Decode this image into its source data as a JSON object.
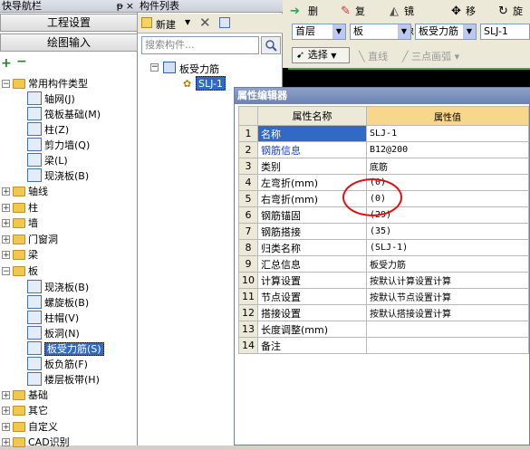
{
  "nav": {
    "title": "快导航栏",
    "pin": "ᵽ",
    "close": "×",
    "buttons": [
      "工程设置",
      "绘图输入"
    ],
    "tree": [
      {
        "label": "常用构件类型",
        "type": "folder",
        "expanded": true
      },
      {
        "label": "轴网(J)",
        "type": "item"
      },
      {
        "label": "筏板基础(M)",
        "type": "item"
      },
      {
        "label": "柱(Z)",
        "type": "item"
      },
      {
        "label": "剪力墙(Q)",
        "type": "item"
      },
      {
        "label": "梁(L)",
        "type": "item"
      },
      {
        "label": "现浇板(B)",
        "type": "item"
      },
      {
        "label": "轴线",
        "type": "folder"
      },
      {
        "label": "柱",
        "type": "folder"
      },
      {
        "label": "墙",
        "type": "folder"
      },
      {
        "label": "门窗洞",
        "type": "folder"
      },
      {
        "label": "梁",
        "type": "folder"
      },
      {
        "label": "板",
        "type": "folder",
        "expanded": true
      },
      {
        "label": "现浇板(B)",
        "type": "item"
      },
      {
        "label": "螺旋板(B)",
        "type": "item"
      },
      {
        "label": "柱帽(V)",
        "type": "item"
      },
      {
        "label": "板洞(N)",
        "type": "item"
      },
      {
        "label": "板受力筋(S)",
        "type": "item",
        "selected": true
      },
      {
        "label": "板负筋(F)",
        "type": "item"
      },
      {
        "label": "楼层板带(H)",
        "type": "item"
      },
      {
        "label": "基础",
        "type": "folder"
      },
      {
        "label": "其它",
        "type": "folder"
      },
      {
        "label": "自定义",
        "type": "folder"
      },
      {
        "label": "CAD识别",
        "type": "folder"
      }
    ]
  },
  "component_list": {
    "title": "构件列表",
    "new_label": "新建",
    "search_placeholder": "搜索构件...",
    "root": "板受力筋",
    "child": "SLJ-1"
  },
  "toolbar": {
    "delete": "删除",
    "copy": "复制",
    "mirror": "镜像",
    "move": "移动",
    "rotate": "旋转",
    "floor": "首层",
    "category": "板",
    "type": "板受力筋",
    "component": "SLJ-1",
    "select": "选择",
    "line": "直线",
    "arc": "三点画弧"
  },
  "property_editor": {
    "title": "属性编辑器",
    "col_name": "属性名称",
    "col_value": "属性值",
    "rows": [
      {
        "n": "1",
        "name": "名称",
        "value": "SLJ-1"
      },
      {
        "n": "2",
        "name": "钢筋信息",
        "value": "B12@200"
      },
      {
        "n": "3",
        "name": "类别",
        "value": "底筋"
      },
      {
        "n": "4",
        "name": "左弯折(mm)",
        "value": "(0)"
      },
      {
        "n": "5",
        "name": "右弯折(mm)",
        "value": "(0)"
      },
      {
        "n": "6",
        "name": "钢筋锚固",
        "value": "(29)"
      },
      {
        "n": "7",
        "name": "钢筋搭接",
        "value": "(35)"
      },
      {
        "n": "8",
        "name": "归类名称",
        "value": "(SLJ-1)"
      },
      {
        "n": "9",
        "name": "汇总信息",
        "value": "板受力筋"
      },
      {
        "n": "10",
        "name": "计算设置",
        "value": "按默认计算设置计算"
      },
      {
        "n": "11",
        "name": "节点设置",
        "value": "按默认节点设置计算"
      },
      {
        "n": "12",
        "name": "搭接设置",
        "value": "按默认搭接设置计算"
      },
      {
        "n": "13",
        "name": "长度调整(mm)",
        "value": ""
      },
      {
        "n": "14",
        "name": "备注",
        "value": ""
      }
    ]
  }
}
